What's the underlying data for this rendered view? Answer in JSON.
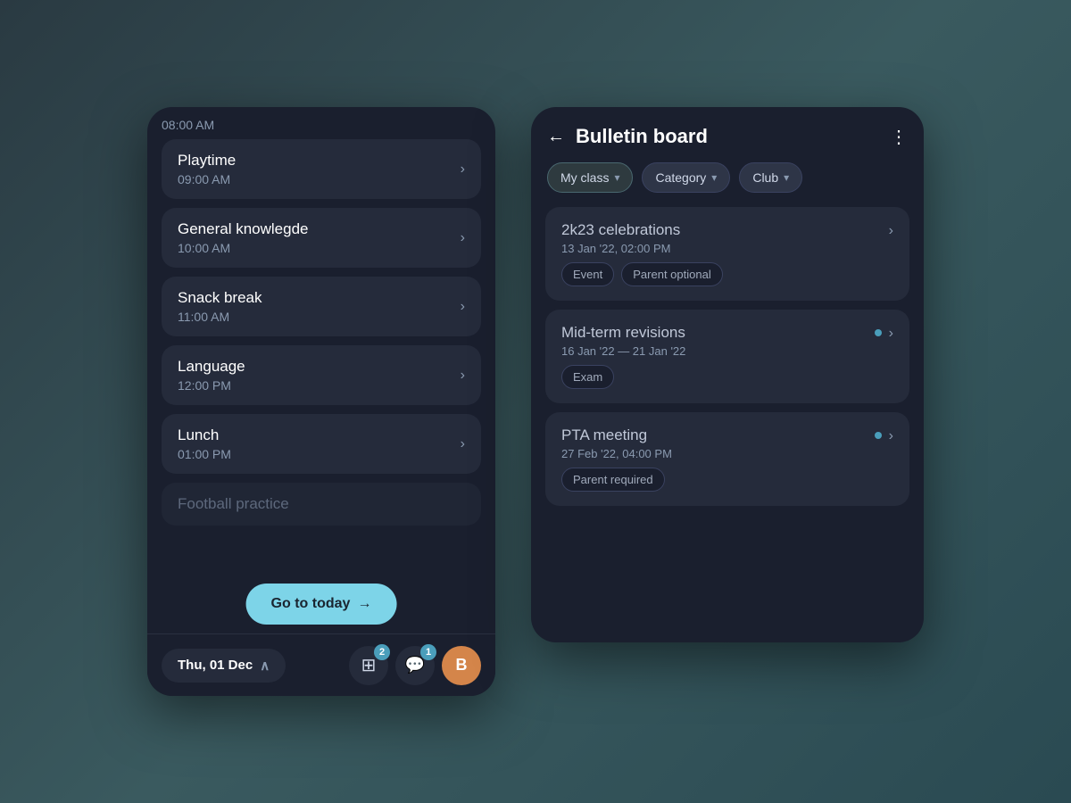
{
  "left_phone": {
    "time_header": "08:00 AM",
    "schedule_items": [
      {
        "title": "Playtime",
        "time": "09:00 AM"
      },
      {
        "title": "General knowlegde",
        "time": "10:00 AM"
      },
      {
        "title": "Snack break",
        "time": "11:00 AM"
      },
      {
        "title": "Language",
        "time": "12:00 PM"
      },
      {
        "title": "Lunch",
        "time": "01:00 PM"
      }
    ],
    "football_practice": "Football practice",
    "go_to_today": "Go to today",
    "go_to_today_arrow": "→",
    "bottom_bar": {
      "date": "Thu, 01 Dec",
      "chevron_up": "∧",
      "badge1": "2",
      "badge2": "1",
      "avatar": "B"
    }
  },
  "right_phone": {
    "header": {
      "back_label": "←",
      "title": "Bulletin board",
      "more_icon": "⋮"
    },
    "filters": [
      {
        "label": "My class",
        "active": true
      },
      {
        "label": "Category",
        "active": false
      },
      {
        "label": "Club",
        "active": false
      }
    ],
    "cards": [
      {
        "title": "2k23 celebrations",
        "date": "13 Jan '22, 02:00 PM",
        "tags": [
          "Event",
          "Parent optional"
        ],
        "has_dot": false
      },
      {
        "title": "Mid-term revisions",
        "date": "16 Jan '22 — 21 Jan '22",
        "tags": [
          "Exam"
        ],
        "has_dot": true
      },
      {
        "title": "PTA meeting",
        "date": "27 Feb '22, 04:00 PM",
        "tags": [
          "Parent required"
        ],
        "has_dot": true
      }
    ],
    "chevron_right": "›"
  },
  "icons": {
    "grid_icon": "⊞",
    "chat_icon": "💬",
    "chevron_right": "›",
    "chevron_up": "∧",
    "back_arrow": "←"
  }
}
